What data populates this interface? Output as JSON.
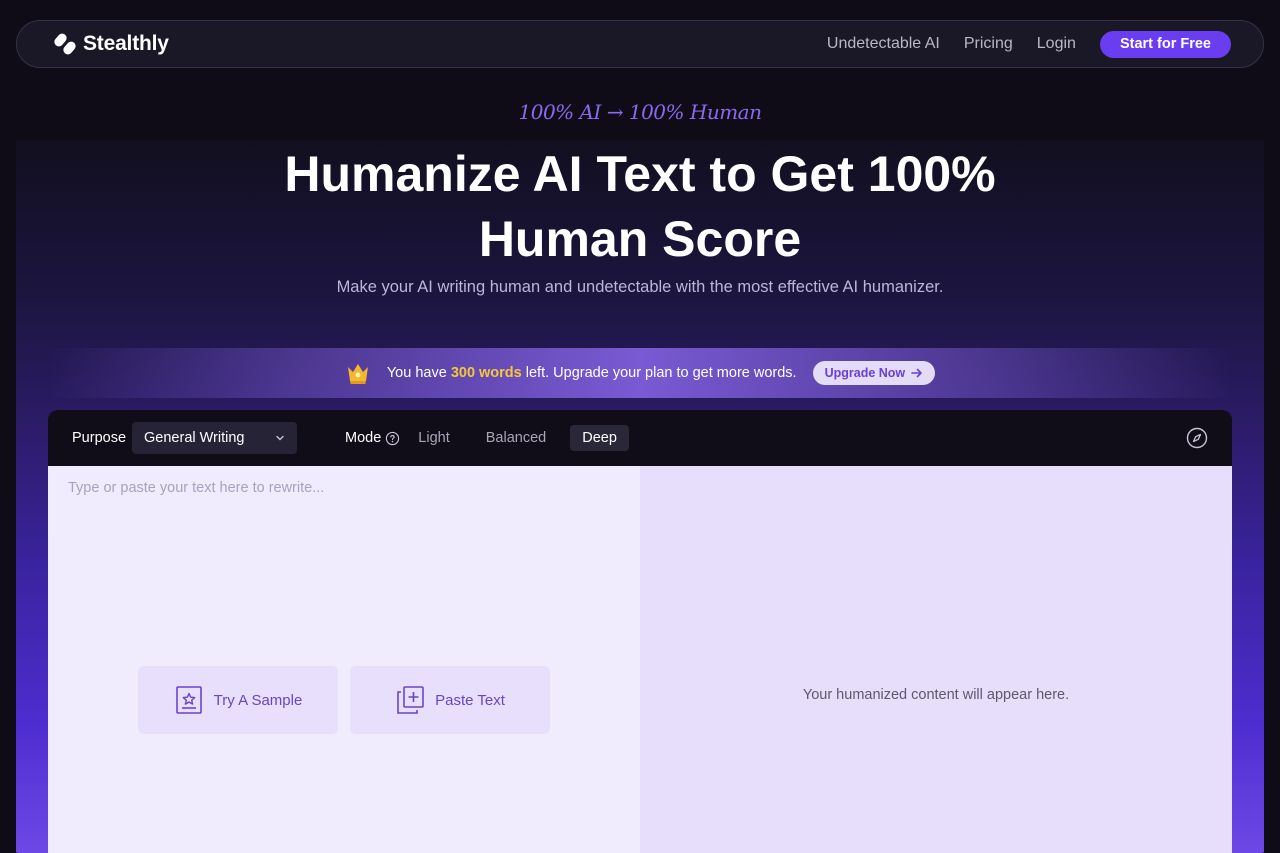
{
  "nav": {
    "logo_text": "Stealthly",
    "links": [
      "Undetectable AI",
      "Pricing",
      "Login"
    ],
    "cta": "Start for Free"
  },
  "hero": {
    "tagline": "100% AI → 100% Human",
    "title": "Humanize AI Text to Get 100% Human Score",
    "subtitle": "Make your AI writing human and undetectable with the most effective AI humanizer."
  },
  "banner": {
    "prefix": "You have ",
    "highlight": "300 words",
    "suffix": " left. Upgrade your plan to get more words.",
    "button": "Upgrade Now",
    "icon": "crown-icon"
  },
  "editor": {
    "purpose_label": "Purpose",
    "purpose_value": "General Writing",
    "mode_label": "Mode",
    "modes": [
      "Light",
      "Balanced",
      "Deep"
    ],
    "active_mode": "Deep",
    "input_placeholder": "Type or paste your text here to rewrite...",
    "try_sample": "Try A Sample",
    "paste_text": "Paste Text",
    "output_placeholder": "Your humanized content will appear here."
  },
  "colors": {
    "accent": "#6a3df0",
    "highlight": "#f5c73b",
    "tagline": "#8a68f0"
  }
}
